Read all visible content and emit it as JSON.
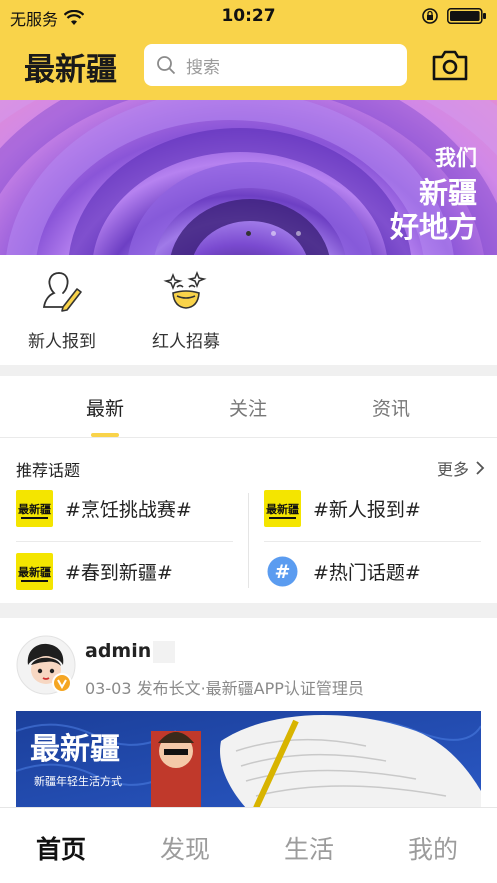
{
  "status_bar": {
    "carrier": "无服务",
    "time": "10:27"
  },
  "header": {
    "logo_text": "最新疆",
    "search_placeholder": "搜索",
    "accent_color": "#f9d34a"
  },
  "banner": {
    "line1": "我们",
    "line2": "新疆",
    "line3": "好地方",
    "dots": 3,
    "active_dot": 1
  },
  "quick_entries": [
    {
      "label": "新人报到",
      "icon": "user-pen-icon"
    },
    {
      "label": "红人招募",
      "icon": "star-face-icon"
    }
  ],
  "feed_tabs": [
    {
      "label": "最新",
      "active": true
    },
    {
      "label": "关注",
      "active": false
    },
    {
      "label": "资讯",
      "active": false
    }
  ],
  "topics": {
    "title": "推荐话题",
    "more": "更多",
    "items": [
      {
        "text": "#烹饪挑战赛#",
        "icon": "logo-thumb-icon"
      },
      {
        "text": "#新人报到#",
        "icon": "logo-thumb-icon"
      },
      {
        "text": "#春到新疆#",
        "icon": "logo-thumb-icon"
      },
      {
        "text": "#热门话题#",
        "icon": "hash-icon"
      }
    ]
  },
  "post": {
    "username": "admin",
    "meta": "03-03  发布长文·最新疆APP认证管理员",
    "image_title": "最新疆",
    "image_subtitle": "新疆年轻生活方式"
  },
  "bottom_nav": [
    {
      "label": "首页",
      "active": true
    },
    {
      "label": "发现",
      "active": false
    },
    {
      "label": "生活",
      "active": false
    },
    {
      "label": "我的",
      "active": false
    }
  ]
}
